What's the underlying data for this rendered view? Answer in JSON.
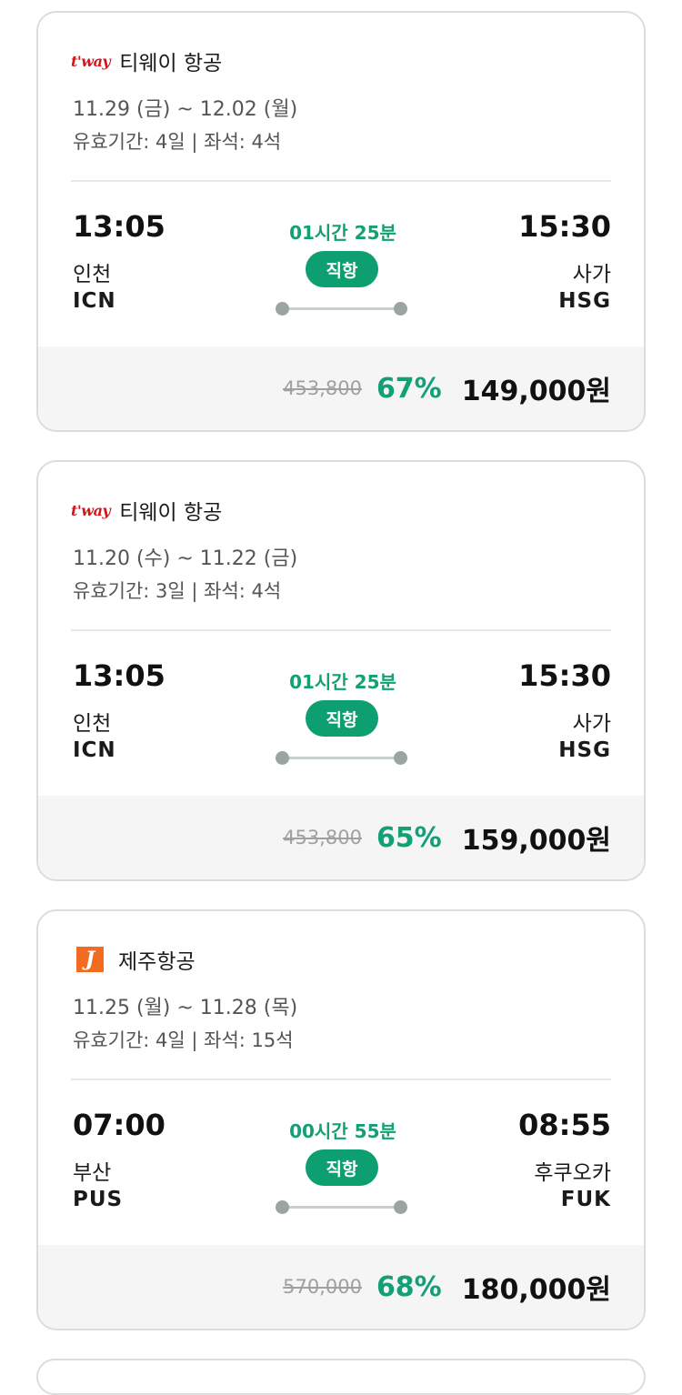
{
  "cards": [
    {
      "airline_logo": "t'way",
      "airline_name": "티웨이 항공",
      "dates": "11.29 (금) ~ 12.02 (월)",
      "validity": "유효기간: 4일 | 좌석: 4석",
      "dep_time": "13:05",
      "dep_city": "인천",
      "dep_code": "ICN",
      "duration": "01시간 25분",
      "badge": "직항",
      "arr_time": "15:30",
      "arr_city": "사가",
      "arr_code": "HSG",
      "original_price": "453,800",
      "discount": "67%",
      "final_price": "149,000원"
    },
    {
      "airline_logo": "t'way",
      "airline_name": "티웨이 항공",
      "dates": "11.20 (수) ~ 11.22 (금)",
      "validity": "유효기간: 3일 | 좌석: 4석",
      "dep_time": "13:05",
      "dep_city": "인천",
      "dep_code": "ICN",
      "duration": "01시간 25분",
      "badge": "직항",
      "arr_time": "15:30",
      "arr_city": "사가",
      "arr_code": "HSG",
      "original_price": "453,800",
      "discount": "65%",
      "final_price": "159,000원"
    },
    {
      "airline_logo": "J",
      "airline_name": "제주항공",
      "dates": "11.25 (월) ~ 11.28 (목)",
      "validity": "유효기간: 4일 | 좌석: 15석",
      "dep_time": "07:00",
      "dep_city": "부산",
      "dep_code": "PUS",
      "duration": "00시간 55분",
      "badge": "직항",
      "arr_time": "08:55",
      "arr_city": "후쿠오카",
      "arr_code": "FUK",
      "original_price": "570,000",
      "discount": "68%",
      "final_price": "180,000원"
    }
  ],
  "colors": {
    "accent_green": "#13a074",
    "tway_red": "#d4151c",
    "jeju_orange": "#f26b21"
  }
}
